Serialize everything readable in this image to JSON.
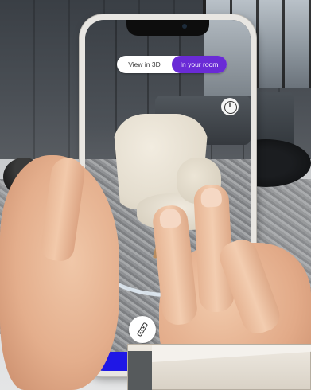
{
  "ar_app": {
    "view_toggle": {
      "options": [
        "View in 3D",
        "In your room"
      ],
      "active_index": 1,
      "active_color": "#6a2bd6"
    },
    "icons": {
      "info": "info-icon",
      "info_glyph": "i",
      "measure": "ruler-icon"
    },
    "cta_color": "#1f17e6"
  }
}
